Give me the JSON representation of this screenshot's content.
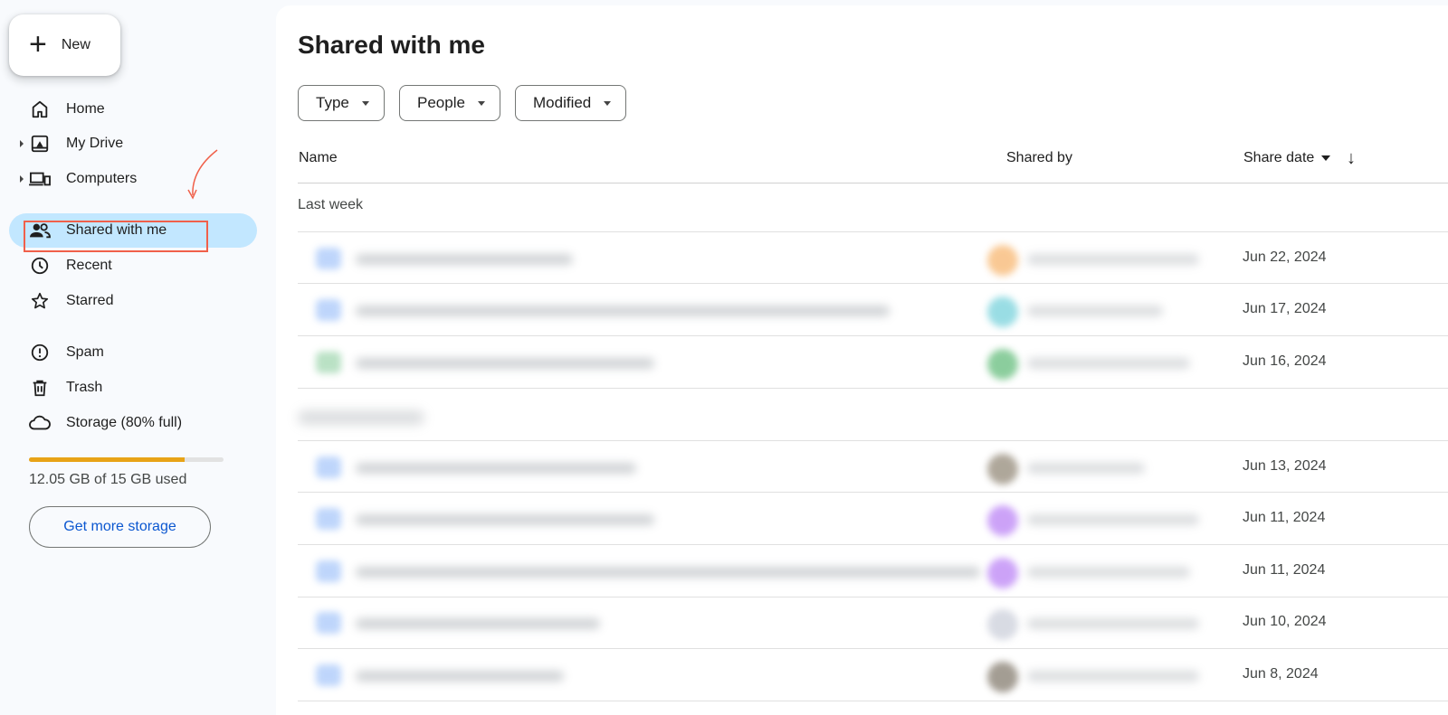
{
  "new_button": {
    "label": "New"
  },
  "nav": [
    {
      "id": "home",
      "label": "Home",
      "icon": "home-icon",
      "caret": false
    },
    {
      "id": "my-drive",
      "label": "My Drive",
      "icon": "drive-icon",
      "caret": true
    },
    {
      "id": "computers",
      "label": "Computers",
      "icon": "computers-icon",
      "caret": true
    },
    {
      "id": "shared",
      "label": "Shared with me",
      "icon": "people-icon",
      "caret": false,
      "active": true
    },
    {
      "id": "recent",
      "label": "Recent",
      "icon": "clock-icon",
      "caret": false
    },
    {
      "id": "starred",
      "label": "Starred",
      "icon": "star-icon",
      "caret": false
    },
    {
      "id": "spam",
      "label": "Spam",
      "icon": "spam-icon",
      "caret": false
    },
    {
      "id": "trash",
      "label": "Trash",
      "icon": "trash-icon",
      "caret": false
    },
    {
      "id": "storage",
      "label": "Storage (80% full)",
      "icon": "cloud-icon",
      "caret": false
    }
  ],
  "storage": {
    "used_text": "12.05 GB of 15 GB used",
    "fraction": 0.8,
    "button": "Get more storage"
  },
  "page_title": "Shared with me",
  "filters": {
    "type": "Type",
    "people": "People",
    "modified": "Modified"
  },
  "columns": {
    "name": "Name",
    "shared_by": "Shared by",
    "share_date": "Share date"
  },
  "groups": {
    "last_week": "Last week"
  },
  "rows": [
    {
      "date": "Jun 22, 2024",
      "icon_color": "#8ab4f8",
      "avatar_color": "#f7b267"
    },
    {
      "date": "Jun 17, 2024",
      "icon_color": "#8ab4f8",
      "avatar_color": "#6fcfd9"
    },
    {
      "date": "Jun 16, 2024",
      "icon_color": "#81c995",
      "avatar_color": "#5bb974"
    },
    {
      "date": "Jun 13, 2024",
      "icon_color": "#8ab4f8",
      "avatar_color": "#8d8270"
    },
    {
      "date": "Jun 11, 2024",
      "icon_color": "#8ab4f8",
      "avatar_color": "#b77cf5"
    },
    {
      "date": "Jun 11, 2024",
      "icon_color": "#8ab4f8",
      "avatar_color": "#b77cf5"
    },
    {
      "date": "Jun 10, 2024",
      "icon_color": "#8ab4f8",
      "avatar_color": "#c8ccd8"
    },
    {
      "date": "Jun 8, 2024",
      "icon_color": "#8ab4f8",
      "avatar_color": "#7d7466"
    }
  ],
  "colors": {
    "active_nav": "#c2e7ff",
    "accent": "#0b57d0",
    "storage_fill": "#e8a317",
    "highlight_box": "#f0604a"
  }
}
